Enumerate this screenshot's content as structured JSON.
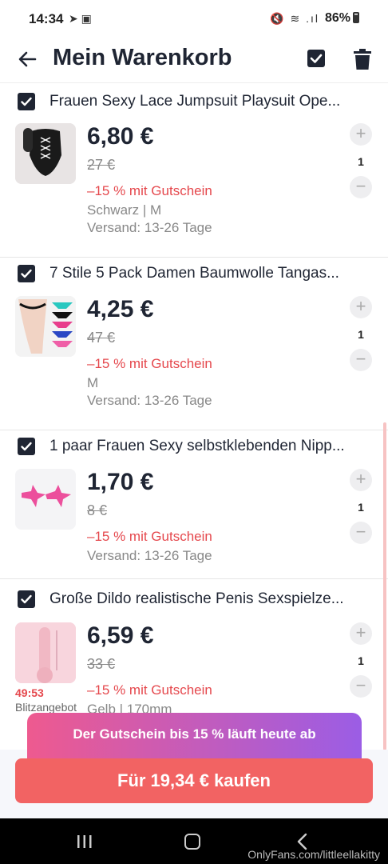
{
  "status_bar": {
    "time": "14:34",
    "left_icons": "➤ ▣",
    "right_icons": "🔇 ≋ .ıl",
    "battery": "86%"
  },
  "header": {
    "title": "Mein Warenkorb",
    "back_icon": "arrow-left-icon",
    "select_all_icon": "checkbox-checked-icon",
    "delete_icon": "trash-icon"
  },
  "items": [
    {
      "name": "Frauen Sexy Lace Jumpsuit Playsuit Ope...",
      "price": "6,80 €",
      "old_price": "27 €",
      "coupon": "–15 % mit Gutschein",
      "variant": "Schwarz | M",
      "shipping": "Versand: 13-26 Tage",
      "quantity": "1"
    },
    {
      "name": "7 Stile 5 Pack Damen Baumwolle Tangas...",
      "price": "4,25 €",
      "old_price": "47 €",
      "coupon": "–15 % mit Gutschein",
      "variant": "M",
      "shipping": "Versand: 13-26 Tage",
      "quantity": "1"
    },
    {
      "name": "1 paar Frauen Sexy selbstklebenden Nipp...",
      "price": "1,70 €",
      "old_price": "8 €",
      "coupon": "–15 % mit Gutschein",
      "shipping": "Versand: 13-26 Tage",
      "quantity": "1"
    },
    {
      "name": "Große Dildo realistische Penis Sexspielze...",
      "price": "6,59 €",
      "old_price": "33 €",
      "coupon": "–15 % mit Gutschein",
      "variant": "Gelb | 170mm",
      "flash_timer": "49:53",
      "flash_label": "Blitzangebot",
      "quantity": "1"
    }
  ],
  "coupon_banner": "Der Gutschein bis 15 % läuft heute ab",
  "buy_button": "Für 19,34 € kaufen",
  "watermark": "OnlyFans.com/littleellakitty",
  "colors": {
    "accent": "#f26363",
    "coupon_red": "#e5484d",
    "dark": "#1f2533"
  }
}
